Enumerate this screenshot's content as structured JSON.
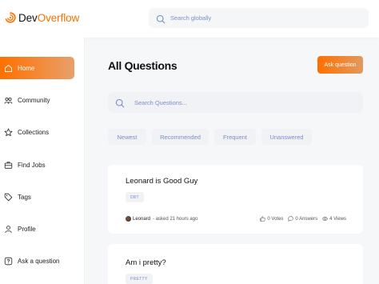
{
  "brand": {
    "name_part1": "Dev",
    "name_part2": "Overflow",
    "accent": "#ff7000"
  },
  "global_search": {
    "placeholder": "Search globally"
  },
  "sidebar": {
    "items": [
      {
        "label": "Home",
        "icon": "home-icon",
        "active": true
      },
      {
        "label": "Community",
        "icon": "community-icon",
        "active": false
      },
      {
        "label": "Collections",
        "icon": "star-icon",
        "active": false
      },
      {
        "label": "Find Jobs",
        "icon": "briefcase-icon",
        "active": false
      },
      {
        "label": "Tags",
        "icon": "tag-icon",
        "active": false
      },
      {
        "label": "Profile",
        "icon": "user-icon",
        "active": false
      },
      {
        "label": "Ask a question",
        "icon": "question-icon",
        "active": false
      }
    ]
  },
  "main": {
    "title": "All Questions",
    "ask_button": "Ask question",
    "search": {
      "placeholder": "Search Questions..."
    },
    "filters": [
      "Newest",
      "Recommended",
      "Frequent",
      "Unanswered"
    ],
    "questions": [
      {
        "title": "Leonard is Good Guy",
        "tags": [
          "DBT"
        ],
        "author": "Leonard",
        "asked": "- asked 21 hours ago",
        "votes": "0 Votes",
        "answers": "0 Answers",
        "views": "4 Views"
      },
      {
        "title": "Am i pretty?",
        "tags": [
          "PRETTY"
        ]
      }
    ]
  }
}
